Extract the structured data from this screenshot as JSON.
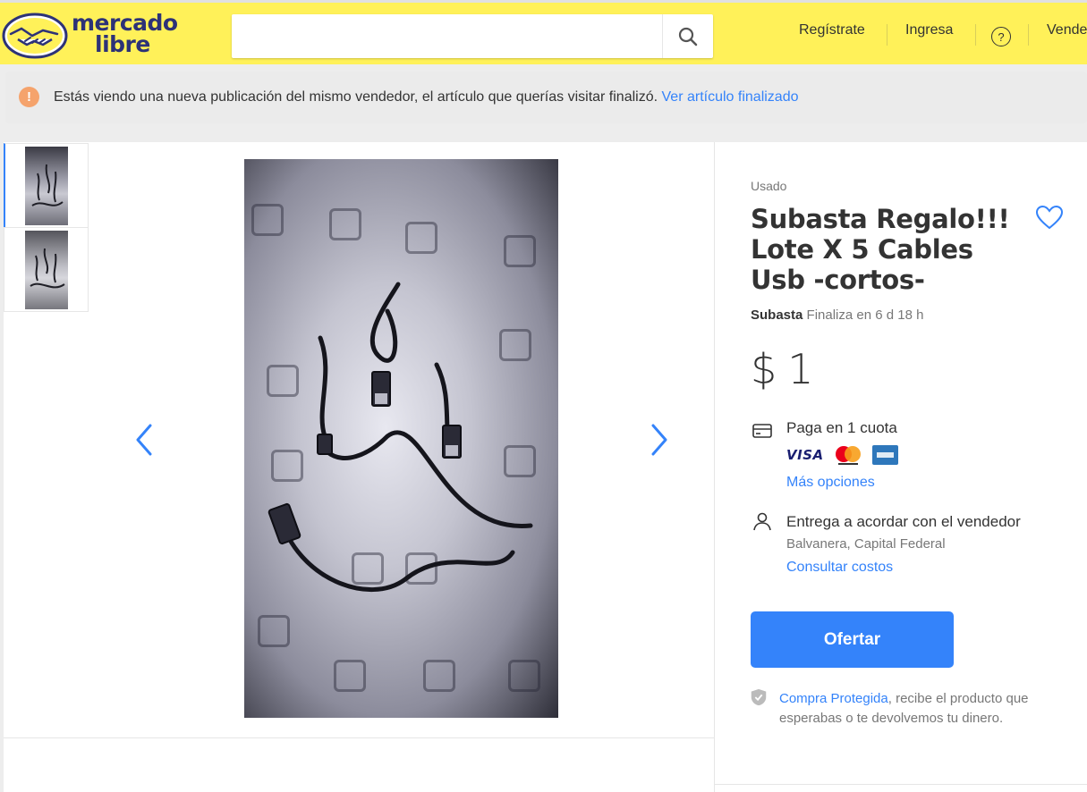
{
  "header": {
    "logo_line1": "mercado",
    "logo_line2": "libre",
    "search_placeholder": "",
    "nav": [
      "Regístrate",
      "Ingresa",
      "Vende"
    ],
    "help_label": "?",
    "colors": {
      "bar": "#fff159",
      "brand_blue": "#2d3277",
      "accent": "#3483fa"
    }
  },
  "notice": {
    "icon": "exclamation-icon",
    "text": "Estás viendo una nueva publicación del mismo vendedor, el artículo que querías visitar finalizó.",
    "link": "Ver artículo finalizado"
  },
  "gallery": {
    "thumbnails": [
      "cables-photo-1",
      "cables-photo-2"
    ],
    "active_index": 0,
    "prev_icon": "chevron-left-icon",
    "next_icon": "chevron-right-icon"
  },
  "product": {
    "condition": "Usado",
    "title": "Subasta Regalo!!! Lote X 5 Cables Usb -cortos-",
    "auction_label": "Subasta",
    "auction_status": "Finaliza en 6 d 18 h",
    "currency": "$",
    "price": "1",
    "payment_text": "Paga en 1 cuota",
    "payment_brands": [
      "VISA",
      "mastercard",
      "american-express"
    ],
    "more_options": "Más opciones",
    "delivery_text": "Entrega a acordar con el vendedor",
    "location": "Balvanera, Capital Federal",
    "shipping_link": "Consultar costos",
    "cta": "Ofertar",
    "protect_link": "Compra Protegida",
    "protect_text": ", recibe el producto que esperabas o te devolvemos tu dinero."
  }
}
